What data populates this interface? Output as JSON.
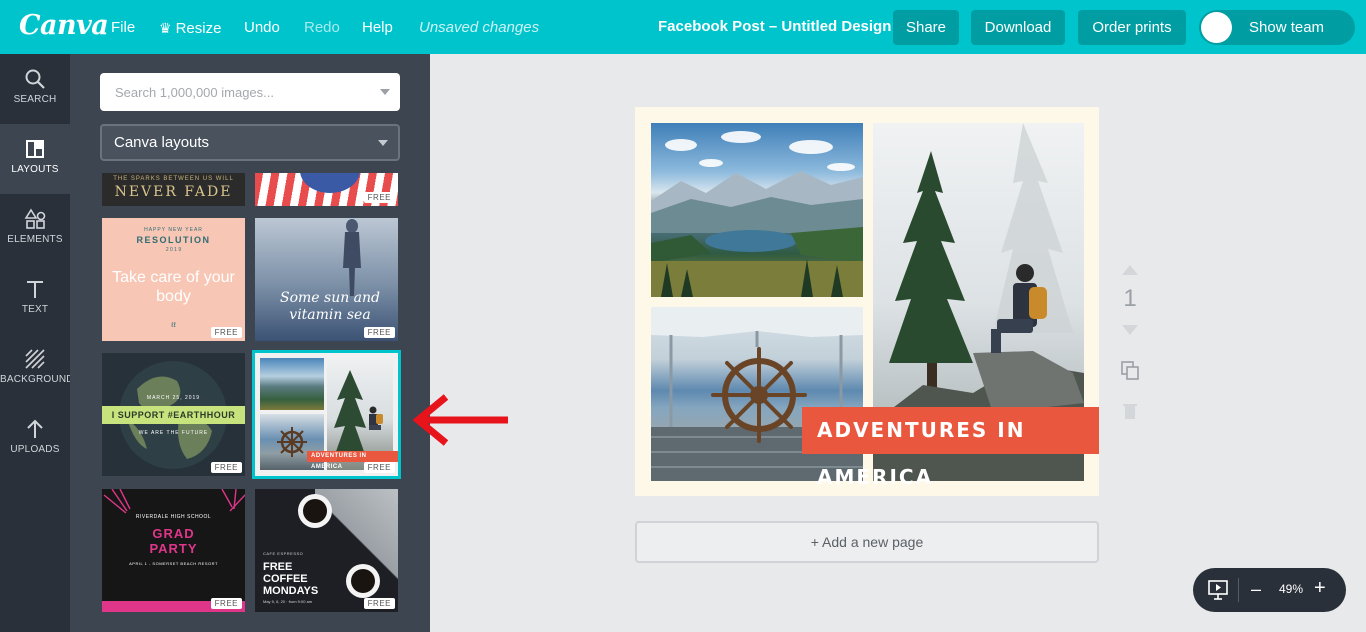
{
  "topbar": {
    "logo": "Canva",
    "menu": {
      "file": "File",
      "resize": "Resize",
      "undo": "Undo",
      "redo": "Redo",
      "help": "Help",
      "status": "Unsaved changes"
    },
    "title": "Facebook Post – Untitled Design",
    "share": "Share",
    "download": "Download",
    "order_prints": "Order prints",
    "show_team": "Show team"
  },
  "rail": [
    {
      "label": "SEARCH",
      "icon": "magnifier-icon"
    },
    {
      "label": "LAYOUTS",
      "icon": "layout-icon"
    },
    {
      "label": "ELEMENTS",
      "icon": "shapes-icon"
    },
    {
      "label": "TEXT",
      "icon": "text-t-icon"
    },
    {
      "label": "BACKGROUND",
      "icon": "hatch-icon"
    },
    {
      "label": "UPLOADS",
      "icon": "upload-arrow-icon"
    }
  ],
  "panel": {
    "search_placeholder": "Search 1,000,000 images...",
    "dropdown_value": "Canva layouts",
    "free_badge": "FREE",
    "tiles": {
      "fade_line1": "THE SPARKS BETWEEN US WILL",
      "fade_line2": "NEVER FADE",
      "res_small": "HAPPY NEW YEAR",
      "res_title": "RESOLUTION",
      "res_year": "2 0 1 9",
      "res_body": "Take care of your body",
      "res_mark": "ℓℓ",
      "sun_text": "Some sun and vitamin sea",
      "earth_date": "MARCH 25, 2019",
      "earth_title": "I SUPPORT #EARTHHOUR",
      "earth_sub": "WE ARE THE FUTURE",
      "adv_text": "ADVENTURES IN AMERICA",
      "grad_school": "RIVERDALE HIGH SCHOOL",
      "grad_title1": "GRAD",
      "grad_title2": "PARTY",
      "grad_date": "APRIL 1 - SOMERSET BEACH RESORT",
      "coffee_brand": "CAFE ESPRESSO",
      "coffee_title1": "FREE",
      "coffee_title2": "COFFEE",
      "coffee_title3": "MONDAYS",
      "coffee_date": "May 5, 6, 20 · from 9:00 am"
    }
  },
  "design": {
    "banner": "ADVENTURES IN AMERICA",
    "add_page": "+ Add a new page",
    "page_number": "1"
  },
  "zoom": {
    "minus": "–",
    "value": "49%",
    "plus": "+"
  },
  "colors": {
    "accent": "#00c4cc",
    "banner": "#e9573f",
    "arrow": "#e8141b"
  }
}
